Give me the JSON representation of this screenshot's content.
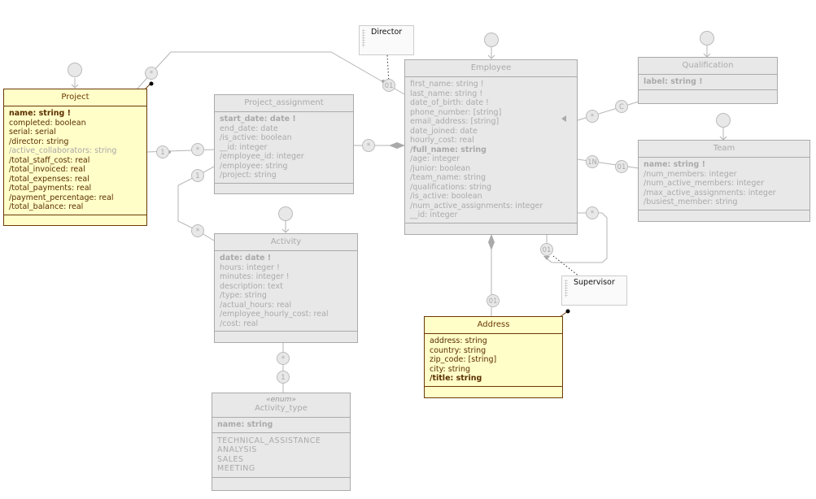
{
  "diagram": {
    "classes": {
      "project": {
        "name": "Project",
        "attributes": [
          {
            "text": "name: string !",
            "bold": true
          },
          {
            "text": "completed: boolean"
          },
          {
            "text": "serial: serial"
          },
          {
            "text": "/director: string"
          },
          {
            "text": "/active_collaborators: string",
            "faint": true
          },
          {
            "text": "/total_staff_cost: real"
          },
          {
            "text": "/total_invoiced: real"
          },
          {
            "text": "/total_expenses: real"
          },
          {
            "text": "/total_payments: real"
          },
          {
            "text": "/payment_percentage: real"
          },
          {
            "text": "/total_balance: real"
          }
        ]
      },
      "project_assignment": {
        "name": "Project_assignment",
        "attributes": [
          {
            "text": "start_date: date !",
            "bold": true
          },
          {
            "text": "end_date: date"
          },
          {
            "text": "/is_active: boolean"
          },
          {
            "text": "__id: integer"
          },
          {
            "text": "/employee_id: integer"
          },
          {
            "text": "/employee: string"
          },
          {
            "text": "/project: string"
          }
        ]
      },
      "employee": {
        "name": "Employee",
        "attributes": [
          {
            "text": "first_name: string !"
          },
          {
            "text": "last_name: string !"
          },
          {
            "text": "date_of_birth: date !"
          },
          {
            "text": "phone_number: [string]"
          },
          {
            "text": "email_address: [string]"
          },
          {
            "text": "date_joined: date"
          },
          {
            "text": "hourly_cost: real"
          },
          {
            "text": "/full_name: string",
            "bold": true
          },
          {
            "text": "/age: integer"
          },
          {
            "text": "/junior: boolean"
          },
          {
            "text": "/team_name: string"
          },
          {
            "text": "/qualifications: string"
          },
          {
            "text": "/is_active: boolean"
          },
          {
            "text": "/num_active_assignments: integer"
          },
          {
            "text": "__id: integer"
          }
        ]
      },
      "qualification": {
        "name": "Qualification",
        "attributes": [
          {
            "text": "label: string !",
            "bold": true
          }
        ]
      },
      "team": {
        "name": "Team",
        "attributes": [
          {
            "text": "name: string !",
            "bold": true
          },
          {
            "text": "/num_members: integer"
          },
          {
            "text": "/num_active_members: integer"
          },
          {
            "text": "/max_active_assignments: integer"
          },
          {
            "text": "/busiest_member: string"
          }
        ]
      },
      "activity": {
        "name": "Activity",
        "attributes": [
          {
            "text": "date: date !",
            "bold": true
          },
          {
            "text": "hours: integer !"
          },
          {
            "text": "minutes: integer !"
          },
          {
            "text": "description: text"
          },
          {
            "text": "/type: string"
          },
          {
            "text": "/actual_hours: real"
          },
          {
            "text": "/employee_hourly_cost: real"
          },
          {
            "text": "/cost: real"
          }
        ]
      },
      "activity_type": {
        "stereotype": "«enum»",
        "name": "Activity_type",
        "attributes": [
          {
            "text": "name: string",
            "bold": true
          }
        ],
        "values": [
          "TECHNICAL_ASSISTANCE",
          "ANALYSIS",
          "SALES",
          "MEETING"
        ]
      },
      "address": {
        "name": "Address",
        "attributes": [
          {
            "text": "address: string"
          },
          {
            "text": "country: string"
          },
          {
            "text": "zip_code: [string]"
          },
          {
            "text": "city: string"
          },
          {
            "text": "/title: string",
            "bold": true
          }
        ]
      }
    },
    "notes": {
      "director": "Director",
      "supervisor": "Supervisor"
    },
    "cardinalities": {
      "project_director_star": "*",
      "employee_director_01": "01",
      "project_pa_1": "1",
      "pa_project_star": "*",
      "pa_employee_star": "*",
      "pa_activity_1": "1",
      "activity_pa_star": "*",
      "employee_qual_star": "*",
      "qual_employee_c": "C",
      "employee_team_1n": "1N",
      "team_employee_01": "01",
      "employee_self_star": "*",
      "employee_self_01": "01",
      "employee_address_01": "01",
      "activity_type_star": "*",
      "activity_type_1": "1"
    },
    "colors": {
      "selected_fill": "#fffdc8",
      "selected_border": "#6b3a06",
      "default_fill": "#e8e8e8",
      "default_border": "#aaaaaa",
      "note_corner": "#f5b88a"
    }
  }
}
